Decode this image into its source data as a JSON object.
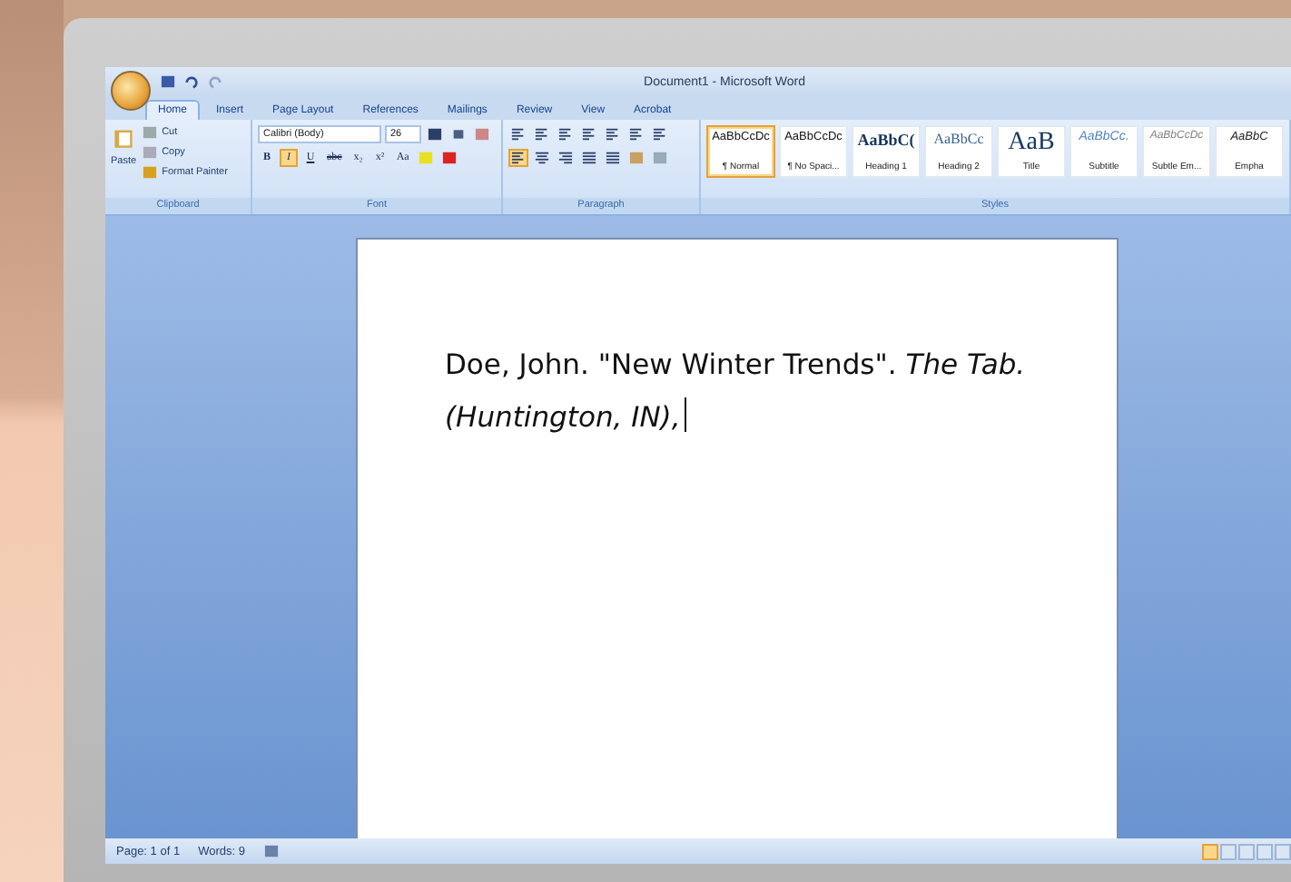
{
  "window": {
    "title": "Document1 - Microsoft Word"
  },
  "tabs": [
    {
      "label": "Home",
      "selected": true
    },
    {
      "label": "Insert",
      "selected": false
    },
    {
      "label": "Page Layout",
      "selected": false
    },
    {
      "label": "References",
      "selected": false
    },
    {
      "label": "Mailings",
      "selected": false
    },
    {
      "label": "Review",
      "selected": false
    },
    {
      "label": "View",
      "selected": false
    },
    {
      "label": "Acrobat",
      "selected": false
    }
  ],
  "clipboard": {
    "paste": "Paste",
    "cut": "Cut",
    "copy": "Copy",
    "format_painter": "Format Painter",
    "label": "Clipboard"
  },
  "font": {
    "face": "Calibri (Body)",
    "size": "26",
    "label": "Font",
    "buttons": [
      {
        "label": "B",
        "kind": "bold",
        "selected": false
      },
      {
        "label": "I",
        "kind": "italic",
        "selected": true
      },
      {
        "label": "U",
        "kind": "underline",
        "selected": false
      },
      {
        "label": "abc",
        "kind": "strike",
        "selected": false
      },
      {
        "label": "x₂",
        "kind": "plain",
        "selected": false
      },
      {
        "label": "x²",
        "kind": "plain",
        "selected": false
      },
      {
        "label": "Aa",
        "kind": "plain",
        "selected": false
      }
    ]
  },
  "paragraph": {
    "label": "Paragraph",
    "alignments": [
      {
        "kind": "left",
        "selected": true
      },
      {
        "kind": "center",
        "selected": false
      },
      {
        "kind": "right",
        "selected": false
      },
      {
        "kind": "justify",
        "selected": false
      }
    ]
  },
  "styles": {
    "label": "Styles",
    "items": [
      {
        "sample": "AaBbCcDc",
        "name": "¶ Normal",
        "kind": "normal",
        "selected": true
      },
      {
        "sample": "AaBbCcDc",
        "name": "¶ No Spaci...",
        "kind": "normal",
        "selected": false
      },
      {
        "sample": "AaBbC(",
        "name": "Heading 1",
        "kind": "heading1",
        "selected": false
      },
      {
        "sample": "AaBbCc",
        "name": "Heading 2",
        "kind": "heading2",
        "selected": false
      },
      {
        "sample": "AaB",
        "name": "Title",
        "kind": "title",
        "selected": false
      },
      {
        "sample": "AaBbCc.",
        "name": "Subtitle",
        "kind": "subtitle",
        "selected": false
      },
      {
        "sample": "AaBbCcDc",
        "name": "Subtle Em...",
        "kind": "subtle",
        "selected": false
      },
      {
        "sample": "AaBbC",
        "name": "Empha",
        "kind": "emphasis",
        "selected": false
      }
    ]
  },
  "document": {
    "text": "Doe, John. \"New Winter Trends\". *The Tab. (Huntington, IN),*"
  },
  "status_bar": {
    "page": "Page: 1 of 1",
    "words": "Words: 9"
  }
}
